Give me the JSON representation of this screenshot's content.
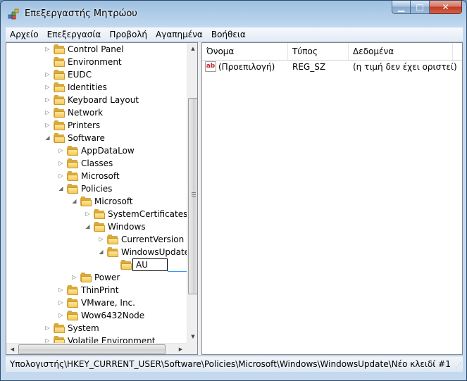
{
  "window": {
    "title": "Επεξεργαστής Μητρώου"
  },
  "caption_buttons": {
    "minimize": "▁",
    "maximize": "□",
    "close": "✕"
  },
  "menu": [
    "Αρχείο",
    "Επεξεργασία",
    "Προβολή",
    "Αγαπημένα",
    "Βοήθεια"
  ],
  "tree": {
    "rows": [
      {
        "label": "Control Panel",
        "level": 0,
        "expander": "▷"
      },
      {
        "label": "Environment",
        "level": 0,
        "expander": ""
      },
      {
        "label": "EUDC",
        "level": 0,
        "expander": "▷"
      },
      {
        "label": "Identities",
        "level": 0,
        "expander": "▷"
      },
      {
        "label": "Keyboard Layout",
        "level": 0,
        "expander": "▷"
      },
      {
        "label": "Network",
        "level": 0,
        "expander": "▷"
      },
      {
        "label": "Printers",
        "level": 0,
        "expander": "▷"
      },
      {
        "label": "Software",
        "level": 0,
        "expander": "◢"
      },
      {
        "label": "AppDataLow",
        "level": 1,
        "expander": "▷"
      },
      {
        "label": "Classes",
        "level": 1,
        "expander": "▷"
      },
      {
        "label": "Microsoft",
        "level": 1,
        "expander": "▷"
      },
      {
        "label": "Policies",
        "level": 1,
        "expander": "◢"
      },
      {
        "label": "Microsoft",
        "level": 2,
        "expander": "◢"
      },
      {
        "label": "SystemCertificates",
        "level": 3,
        "expander": "▷"
      },
      {
        "label": "Windows",
        "level": 3,
        "expander": "◢"
      },
      {
        "label": "CurrentVersion",
        "level": 4,
        "expander": "▷"
      },
      {
        "label": "WindowsUpdate",
        "level": 4,
        "expander": "◢"
      },
      {
        "label": "AU",
        "level": 5,
        "expander": "",
        "editing": true
      },
      {
        "label": "Power",
        "level": 2,
        "expander": "▷"
      },
      {
        "label": "ThinPrint",
        "level": 1,
        "expander": "▷"
      },
      {
        "label": "VMware, Inc.",
        "level": 1,
        "expander": "▷"
      },
      {
        "label": "Wow6432Node",
        "level": 1,
        "expander": "▷"
      },
      {
        "label": "System",
        "level": 0,
        "expander": "▷"
      },
      {
        "label": "Volatile Environment",
        "level": 0,
        "expander": "▷"
      }
    ]
  },
  "scrollbar": {
    "up": "▲",
    "down": "▼",
    "left": "◀",
    "right": "▶"
  },
  "list": {
    "columns": [
      "Όνομα",
      "Τύπος",
      "Δεδομένα"
    ],
    "rows": [
      {
        "icon": "ab",
        "name": "(Προεπιλογή)",
        "type": "REG_SZ",
        "data": "(η τιμή δεν έχει οριστεί)"
      }
    ]
  },
  "status": {
    "path": "Υπολογιστής\\HKEY_CURRENT_USER\\Software\\Policies\\Microsoft\\Windows\\WindowsUpdate\\Νέο κλειδί #1"
  }
}
